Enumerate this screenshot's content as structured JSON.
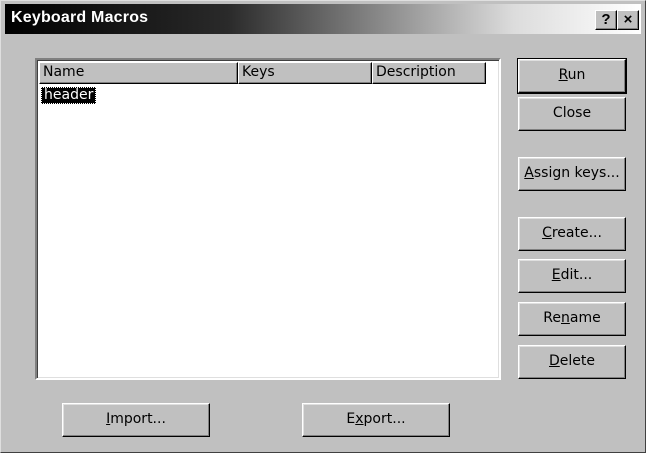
{
  "window": {
    "title": "Keyboard Macros",
    "help_button": "?",
    "close_button": "×"
  },
  "list": {
    "columns": [
      "Name",
      "Keys",
      "Description"
    ],
    "rows": [
      {
        "name": "header",
        "keys": "",
        "description": "",
        "selected": true
      }
    ]
  },
  "buttons": {
    "run": {
      "pre": "",
      "key": "R",
      "post": "un"
    },
    "close": {
      "label": "Close"
    },
    "assign": {
      "pre": "",
      "key": "A",
      "post": "ssign keys..."
    },
    "create": {
      "pre": "",
      "key": "C",
      "post": "reate..."
    },
    "edit": {
      "pre": "",
      "key": "E",
      "post": "dit..."
    },
    "rename": {
      "pre": "Re",
      "key": "n",
      "post": "ame"
    },
    "delete": {
      "pre": "",
      "key": "D",
      "post": "elete"
    },
    "import": {
      "pre": "",
      "key": "I",
      "post": "mport..."
    },
    "export": {
      "pre": "E",
      "key": "x",
      "post": "port..."
    }
  },
  "colors": {
    "face": "#c0c0c0",
    "selection": "#000000",
    "title_gradient_start": "#000000",
    "title_gradient_end": "#ffffff"
  }
}
